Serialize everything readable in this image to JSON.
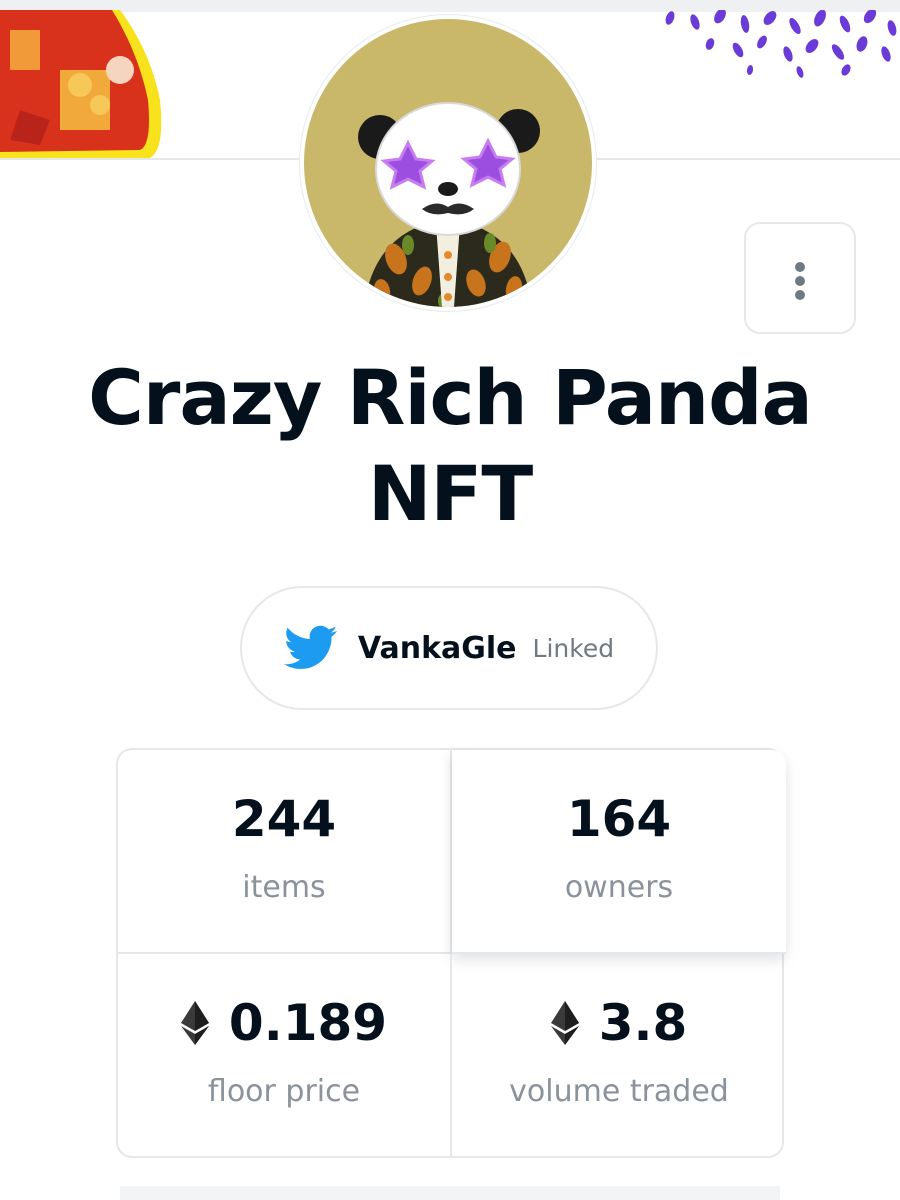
{
  "collection": {
    "title": "Crazy Rich Panda NFT"
  },
  "twitter": {
    "handle": "VankaGle",
    "status": "Linked",
    "icon": "twitter-bird-icon",
    "color": "#1d9bf0"
  },
  "stats": [
    {
      "value": "244",
      "label": "items"
    },
    {
      "value": "164",
      "label": "owners"
    },
    {
      "value": "0.189",
      "label": "floor price",
      "icon": "ethereum-icon"
    },
    {
      "value": "3.8",
      "label": "volume traded",
      "icon": "ethereum-icon"
    }
  ],
  "colors": {
    "avatar_bg": "#c9b86a",
    "banner_red": "#d8321c",
    "banner_yellow": "#f7e21c",
    "dots_purple": "#6a3bd6"
  },
  "more_icon": "more-vertical-icon"
}
